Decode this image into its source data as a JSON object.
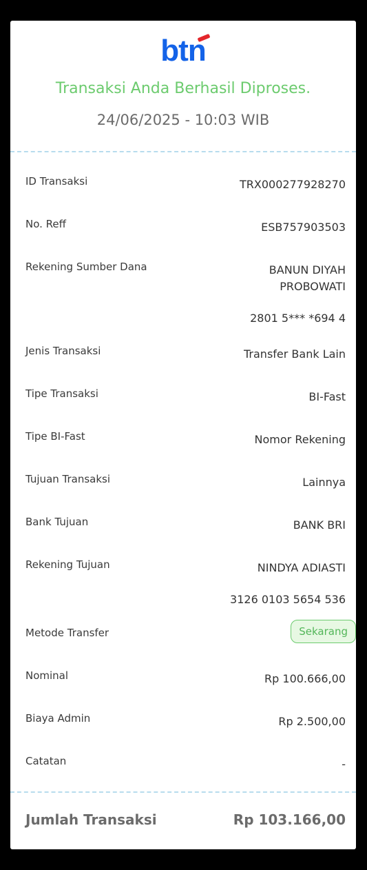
{
  "header": {
    "logo_text": "btn",
    "headline": "Transaksi Anda Berhasil Diproses.",
    "datetime": "24/06/2025 - 10:03 WIB"
  },
  "details": {
    "id_transaksi": {
      "label": "ID Transaksi",
      "value": "TRX000277928270"
    },
    "no_reff": {
      "label": "No. Reff",
      "value": "ESB757903503"
    },
    "rekening_sumber": {
      "label": "Rekening Sumber Dana",
      "name_line1": "BANUN DIYAH",
      "name_line2": "PROBOWATI",
      "account": "2801 5*** *694 4"
    },
    "jenis_transaksi": {
      "label": "Jenis Transaksi",
      "value": "Transfer Bank Lain"
    },
    "tipe_transaksi": {
      "label": "Tipe Transaksi",
      "value": "BI-Fast"
    },
    "tipe_bifast": {
      "label": "Tipe BI-Fast",
      "value": "Nomor Rekening"
    },
    "tujuan_transaksi": {
      "label": "Tujuan Transaksi",
      "value": "Lainnya"
    },
    "bank_tujuan": {
      "label": "Bank Tujuan",
      "value": "BANK BRI"
    },
    "rekening_tujuan": {
      "label": "Rekening Tujuan",
      "name": "NINDYA ADIASTI",
      "account": "3126 0103 5654 536"
    },
    "metode_transfer": {
      "label": "Metode Transfer",
      "value": "Sekarang"
    },
    "nominal": {
      "label": "Nominal",
      "value": "Rp 100.666,00"
    },
    "biaya_admin": {
      "label": "Biaya Admin",
      "value": "Rp 2.500,00"
    },
    "catatan": {
      "label": "Catatan",
      "value": "-"
    }
  },
  "total": {
    "label": "Jumlah Transaksi",
    "value": "Rp 103.166,00"
  },
  "colors": {
    "brand_blue": "#1463e8",
    "brand_red": "#e3262b",
    "success_green": "#6ccb6e"
  }
}
